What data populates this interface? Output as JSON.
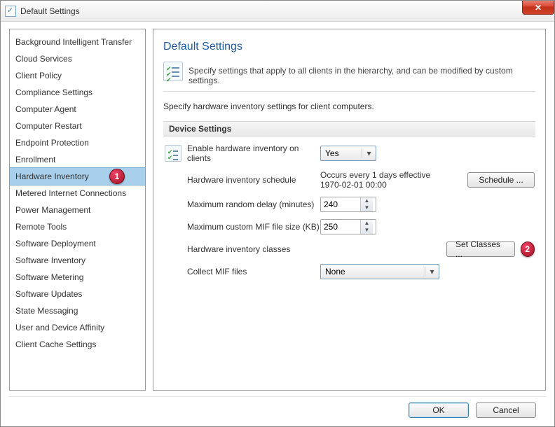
{
  "title": "Default Settings",
  "close_glyph": "✕",
  "sidebar": {
    "items": [
      {
        "label": "Background Intelligent Transfer"
      },
      {
        "label": "Cloud Services"
      },
      {
        "label": "Client Policy"
      },
      {
        "label": "Compliance Settings"
      },
      {
        "label": "Computer Agent"
      },
      {
        "label": "Computer Restart"
      },
      {
        "label": "Endpoint Protection"
      },
      {
        "label": "Enrollment"
      },
      {
        "label": "Hardware Inventory"
      },
      {
        "label": "Metered Internet Connections"
      },
      {
        "label": "Power Management"
      },
      {
        "label": "Remote Tools"
      },
      {
        "label": "Software Deployment"
      },
      {
        "label": "Software Inventory"
      },
      {
        "label": "Software Metering"
      },
      {
        "label": "Software Updates"
      },
      {
        "label": "State Messaging"
      },
      {
        "label": "User and Device Affinity"
      },
      {
        "label": "Client Cache Settings"
      }
    ],
    "selected_index": 8
  },
  "main": {
    "heading": "Default Settings",
    "description": "Specify settings that apply to all clients in the hierarchy, and can be modified by custom settings.",
    "sub_description": "Specify hardware inventory settings for client computers.",
    "section_title": "Device Settings",
    "rows": {
      "enable": {
        "label": "Enable hardware inventory on clients",
        "value": "Yes"
      },
      "schedule": {
        "label": "Hardware inventory schedule",
        "value": "Occurs every 1 days effective 1970-02-01 00:00",
        "button": "Schedule ..."
      },
      "max_delay": {
        "label": "Maximum random delay (minutes)",
        "value": "240"
      },
      "max_mif": {
        "label": "Maximum custom MIF file size (KB)",
        "value": "250"
      },
      "classes": {
        "label": "Hardware inventory classes",
        "button": "Set Classes ..."
      },
      "collect_mif": {
        "label": "Collect MIF files",
        "value": "None"
      }
    }
  },
  "footer": {
    "ok": "OK",
    "cancel": "Cancel"
  },
  "annotations": {
    "one": "1",
    "two": "2"
  }
}
